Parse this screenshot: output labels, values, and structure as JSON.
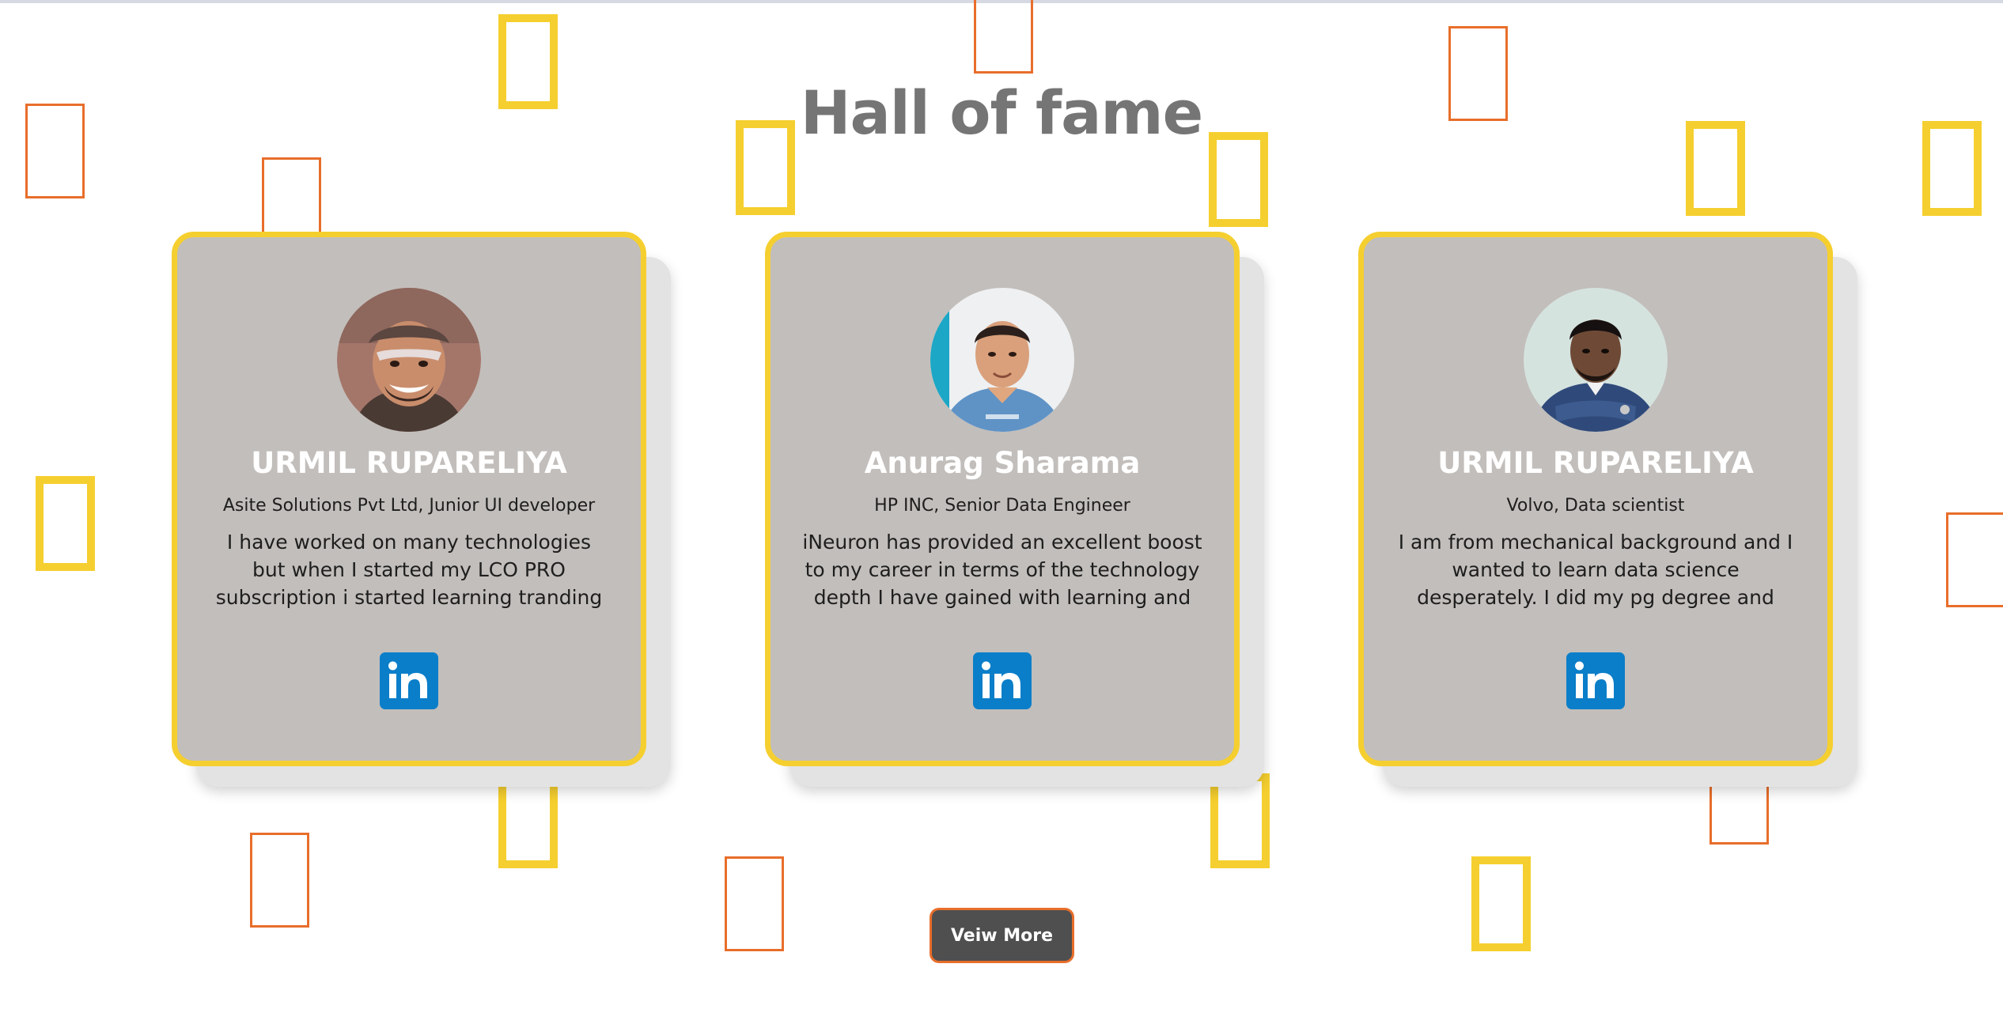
{
  "section": {
    "title": "Hall of fame"
  },
  "cards": [
    {
      "name": "URMIL RUPARELIYA",
      "role": "Asite Solutions Pvt Ltd, Junior UI developer",
      "quote": "I have worked on many technologies but when I started my LCO PRO subscription i started learning tranding technologies.",
      "social_icon": "linkedin-icon"
    },
    {
      "name": "Anurag Sharama",
      "role": "HP INC, Senior Data Engineer",
      "quote": "iNeuron has provided an excellent boost to my career in terms of the technology depth I have gained with learning and",
      "social_icon": "linkedin-icon"
    },
    {
      "name": "URMIL RUPARELIYA",
      "role": "Volvo, Data scientist",
      "quote": "I am from mechanical background and I wanted to learn data science desperately. I did my pg degree and",
      "social_icon": "linkedin-icon"
    }
  ],
  "actions": {
    "view_more_label": "Veiw More"
  },
  "colors": {
    "card_border": "#f5cf2f",
    "card_background": "#c2bebb",
    "deco_orange": "#e86e2b",
    "linkedin_blue": "#0a7ec9",
    "button_background": "#4f4f4f",
    "title_gray": "#757575"
  }
}
